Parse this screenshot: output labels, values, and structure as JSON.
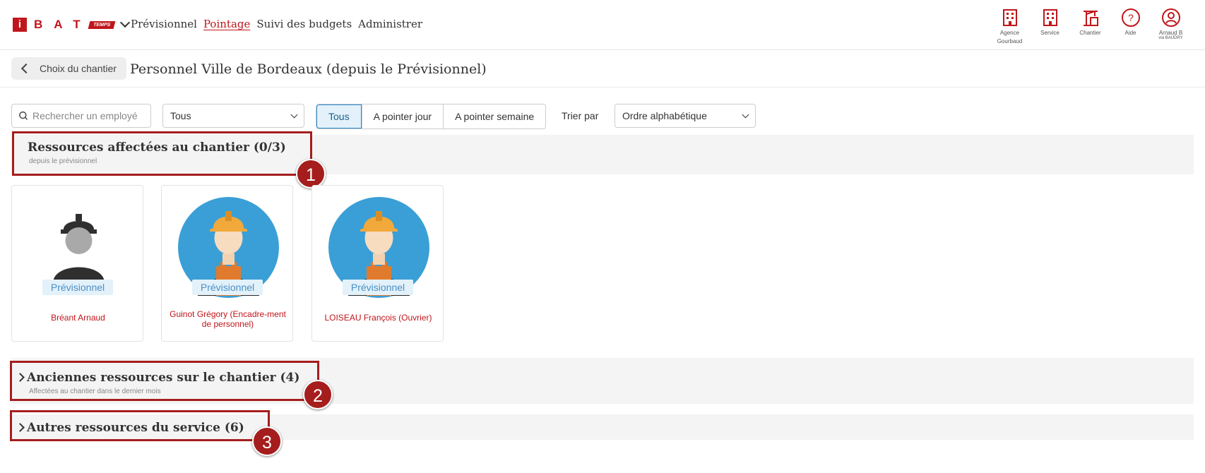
{
  "header": {
    "logo_i": "i",
    "logo_bat": "BAT",
    "logo_temps": "TEMPS",
    "nav": [
      "Prévisionnel",
      "Pointage",
      "Suivi des budgets",
      "Administrer"
    ],
    "nav_active": "Pointage",
    "tools": [
      {
        "icon": "building-icon",
        "label": "Agence",
        "sub": "Gourbaud"
      },
      {
        "icon": "building-icon",
        "label": "Service",
        "sub": ""
      },
      {
        "icon": "crane-icon",
        "label": "Chantier",
        "sub": ""
      },
      {
        "icon": "help-icon",
        "label": "Aide",
        "sub": ""
      },
      {
        "icon": "user-circle-icon",
        "label": "Arnaud B",
        "sub": "via BAUDRY"
      }
    ]
  },
  "breadcrumb": {
    "back_label": "Choix du chantier",
    "title": "Personnel Ville de Bordeaux (depuis le Prévisionnel)"
  },
  "filters": {
    "search_placeholder": "Rechercher un employé",
    "group_select": "Tous",
    "tabs": [
      "Tous",
      "A pointer jour",
      "A pointer semaine"
    ],
    "active_tab": "Tous",
    "sort_label": "Trier par",
    "sort_select": "Ordre alphabétique"
  },
  "sections": {
    "assigned": {
      "title": "Ressources affectées au chantier (0/3)",
      "subtitle": "depuis le prévisionnel"
    },
    "former": {
      "title": "Anciennes ressources sur le chantier (4)",
      "subtitle": "Affectées au chantier dans le dernier mois"
    },
    "others": {
      "title": "Autres ressources du service (6)"
    }
  },
  "employees": [
    {
      "name": "Bréant Arnaud",
      "badge": "Prévisionnel",
      "avatar": "generic-worker"
    },
    {
      "name": "Guinot Grégory (Encadre-ment de personnel)",
      "badge": "Prévisionnel",
      "avatar": "construction-worker"
    },
    {
      "name": "LOISEAU François (Ouvrier)",
      "badge": "Prévisionnel",
      "avatar": "construction-worker"
    }
  ],
  "markers": [
    "1",
    "2",
    "3"
  ],
  "colors": {
    "brand": "#c0161b",
    "marker": "#a51d1d",
    "badge_bg": "#e3f1fa",
    "avatar_bg": "#3a9fd6"
  }
}
